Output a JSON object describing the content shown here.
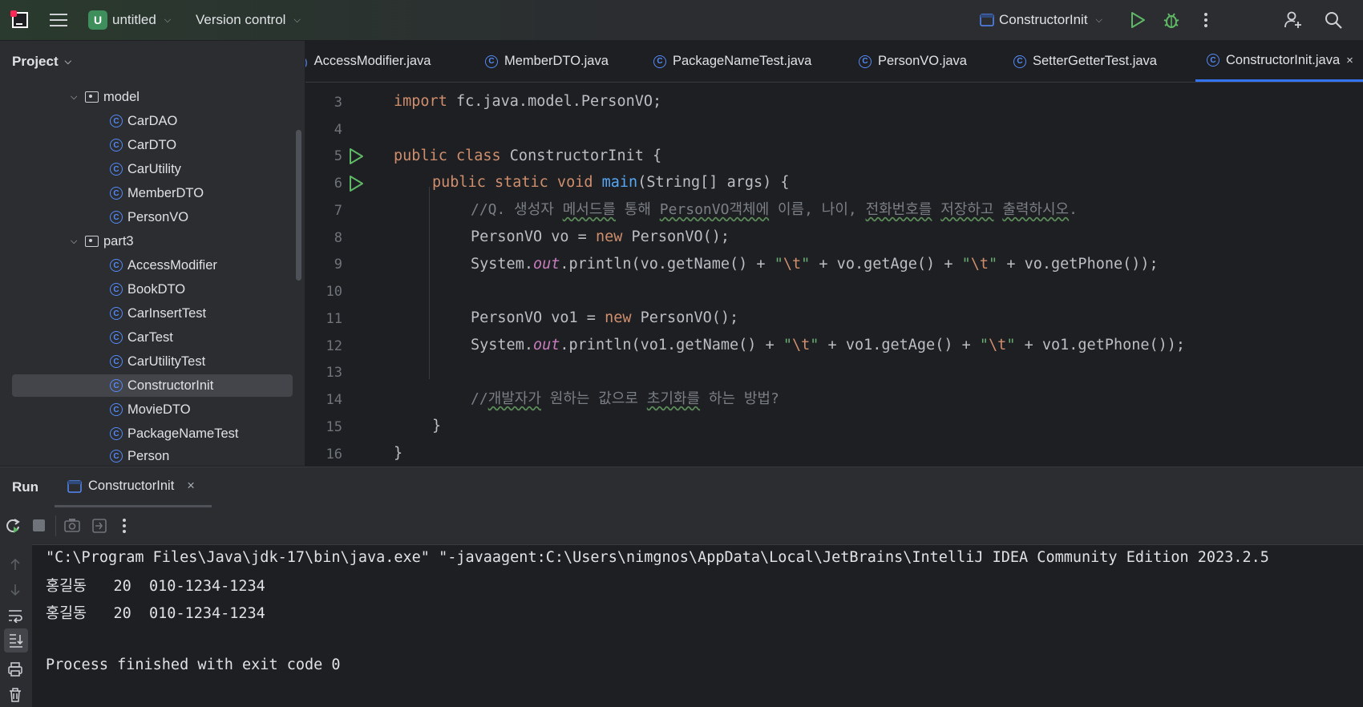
{
  "titlebar": {
    "project_badge": "U",
    "project_name": "untitled",
    "vcs_label": "Version control",
    "run_config": "ConstructorInit"
  },
  "project_panel": {
    "title": "Project",
    "items": [
      {
        "label": "model",
        "type": "package"
      },
      {
        "label": "CarDAO",
        "type": "class"
      },
      {
        "label": "CarDTO",
        "type": "class"
      },
      {
        "label": "CarUtility",
        "type": "class"
      },
      {
        "label": "MemberDTO",
        "type": "class"
      },
      {
        "label": "PersonVO",
        "type": "class"
      },
      {
        "label": "part3",
        "type": "package"
      },
      {
        "label": "AccessModifier",
        "type": "class"
      },
      {
        "label": "BookDTO",
        "type": "class"
      },
      {
        "label": "CarInsertTest",
        "type": "class"
      },
      {
        "label": "CarTest",
        "type": "class"
      },
      {
        "label": "CarUtilityTest",
        "type": "class"
      },
      {
        "label": "ConstructorInit",
        "type": "class",
        "selected": true
      },
      {
        "label": "MovieDTO",
        "type": "class"
      },
      {
        "label": "PackageNameTest",
        "type": "class"
      },
      {
        "label": "Person",
        "type": "class"
      }
    ]
  },
  "tabs": [
    {
      "label": "AccessModifier.java"
    },
    {
      "label": "MemberDTO.java"
    },
    {
      "label": "PackageNameTest.java"
    },
    {
      "label": "PersonVO.java"
    },
    {
      "label": "SetterGetterTest.java"
    },
    {
      "label": "ConstructorInit.java",
      "active": true
    }
  ],
  "editor": {
    "line_numbers": [
      "3",
      "4",
      "5",
      "6",
      "7",
      "8",
      "9",
      "10",
      "11",
      "12",
      "13",
      "14",
      "15",
      "16"
    ],
    "code": {
      "l3_kw": "import",
      "l3_rest": " fc.java.model.PersonVO;",
      "l5_kw": "public class",
      "l5_rest": " ConstructorInit {",
      "l6_kw": "public static void",
      "l6_fn": "main",
      "l6_rest": "(String[] args) {",
      "l7_a": "//Q. 생성자 ",
      "l7_b": "메서드를",
      "l7_c": " 통해 ",
      "l7_d": "PersonVO객체에",
      "l7_e": " 이름, 나이, ",
      "l7_f": "전화번호를",
      "l7_g": " ",
      "l7_h": "저장하고",
      "l7_i": " ",
      "l7_j": "출력하시오",
      "l7_k": ".",
      "l8_a": "PersonVO vo = ",
      "l8_kw": "new",
      "l8_b": " PersonVO();",
      "l9_a": "System.",
      "l9_out": "out",
      "l9_b": ".println(vo.getName() + ",
      "l9_s1a": "\"",
      "l9_s1e": "\\t",
      "l9_s1b": "\"",
      "l9_c": " + vo.getAge() + ",
      "l9_s2a": "\"",
      "l9_s2e": "\\t",
      "l9_s2b": "\"",
      "l9_d": " + vo.getPhone());",
      "l11_a": "PersonVO vo1 = ",
      "l11_kw": "new",
      "l11_b": " PersonVO();",
      "l12_a": "System.",
      "l12_out": "out",
      "l12_b": ".println(vo1.getName() + ",
      "l12_s1a": "\"",
      "l12_s1e": "\\t",
      "l12_s1b": "\"",
      "l12_c": " + vo1.getAge() + ",
      "l12_s2a": "\"",
      "l12_s2e": "\\t",
      "l12_s2b": "\"",
      "l12_d": " + vo1.getPhone());",
      "l14_a": "//",
      "l14_b": "개발자가",
      "l14_c": " 원하는 값으로 ",
      "l14_d": "초기화를",
      "l14_e": " 하는 방법?",
      "l15": "}",
      "l16": "}"
    }
  },
  "run_panel": {
    "title": "Run",
    "tab_label": "ConstructorInit",
    "output": [
      "\"C:\\Program Files\\Java\\jdk-17\\bin\\java.exe\" \"-javaagent:C:\\Users\\nimgnos\\AppData\\Local\\JetBrains\\IntelliJ IDEA Community Edition 2023.2.5",
      "홍길동   20  010-1234-1234",
      "홍길동   20  010-1234-1234",
      "",
      "Process finished with exit code 0"
    ]
  },
  "colors": {
    "background": "#1e1f22",
    "panel": "#2b2d30",
    "keyword": "#cf8e6d",
    "function": "#56a8f5",
    "string": "#6aab73",
    "static_field": "#c77dbb",
    "comment": "#7a7e85",
    "accent": "#3574f0",
    "run_green": "#5fb865"
  }
}
